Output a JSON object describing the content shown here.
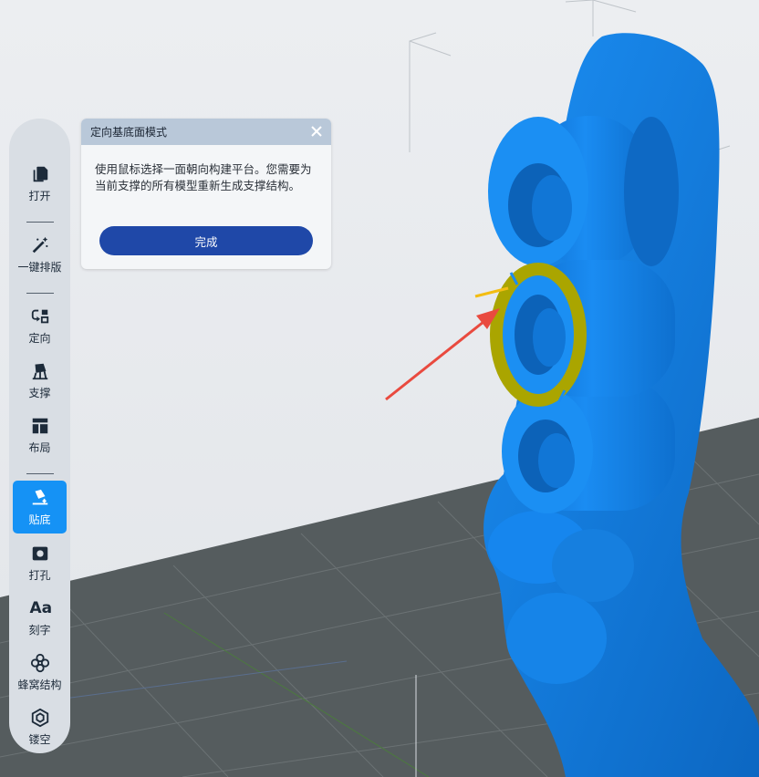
{
  "colors": {
    "accent": "#1592f5",
    "primary_button": "#1f48a8",
    "model": "#1588f0",
    "highlight_face": "#aaa500",
    "annotation_arrow": "#e94a3f",
    "platform": "#555c5e"
  },
  "toolbar": {
    "items": [
      {
        "label": "打开",
        "icon": "file-copy-icon"
      },
      {
        "label": "一键排版",
        "icon": "magic-wand-icon"
      },
      {
        "label": "定向",
        "icon": "orient-icon"
      },
      {
        "label": "支撑",
        "icon": "support-icon"
      },
      {
        "label": "布局",
        "icon": "layout-icon"
      },
      {
        "label": "贴底",
        "icon": "lay-flat-icon",
        "active": true
      },
      {
        "label": "打孔",
        "icon": "hole-punch-icon"
      },
      {
        "label": "刻字",
        "icon": "text-icon",
        "glyph": "Aa"
      },
      {
        "label": "蜂窝结构",
        "icon": "honeycomb-icon"
      },
      {
        "label": "镂空",
        "icon": "hollow-icon"
      }
    ]
  },
  "dialog": {
    "title": "定向基底面模式",
    "message": "使用鼠标选择一面朝向构建平台。您需要为当前支撑的所有模型重新生成支撑结构。",
    "confirm_label": "完成",
    "close_icon": "close-icon"
  }
}
